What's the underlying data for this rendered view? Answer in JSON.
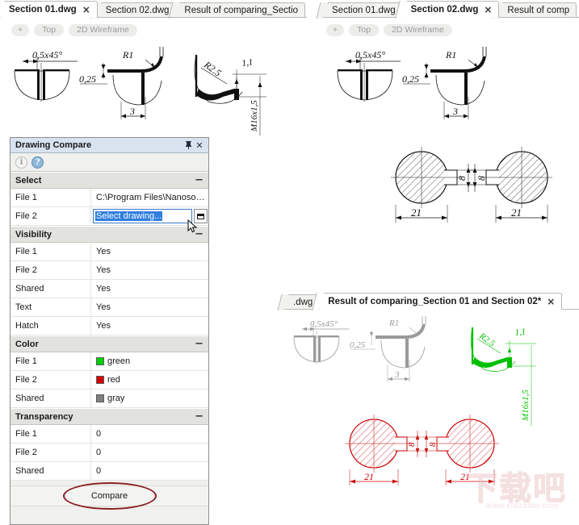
{
  "app": {
    "panel_title": "Drawing Compare"
  },
  "left_view": {
    "tabs": [
      {
        "label": "Section 01.dwg",
        "active": true,
        "close": "×"
      },
      {
        "label": "Section 02.dwg",
        "active": false,
        "close": ""
      },
      {
        "label": "Result of comparing_Sectio",
        "active": false,
        "close": ""
      }
    ],
    "viewbar": [
      "+",
      "Top",
      "2D Wireframe"
    ],
    "drawing_labels": [
      "0,5x45°",
      "0,25",
      "R1",
      "3",
      "R2.5",
      "1,1",
      "M16x1,5"
    ]
  },
  "right_view": {
    "tabs": [
      {
        "label": "Section 01.dwg",
        "active": false,
        "close": ""
      },
      {
        "label": "Section 02.dwg",
        "active": true,
        "close": "×"
      },
      {
        "label": "Result of comp",
        "active": false,
        "close": ""
      }
    ],
    "viewbar": [
      "+",
      "Top",
      "2D Wireframe"
    ],
    "drawing_labels": [
      "0,5x45°",
      "0,25",
      "R1",
      "3",
      "21",
      "8",
      "21",
      "8"
    ]
  },
  "result_view": {
    "tabs": [
      {
        "label": ".dwg",
        "active": false,
        "close": ""
      },
      {
        "label": "Result of comparing_Section 01 and Section 02*",
        "active": true,
        "close": "×"
      }
    ],
    "drawing_labels_shared": [
      "0,5x45°",
      "0,25",
      "R1",
      "3"
    ],
    "drawing_labels_green": [
      "R2.5",
      "1,1",
      "M16x1,5"
    ],
    "drawing_labels_red": [
      "21",
      "8",
      "21",
      "8"
    ]
  },
  "panel": {
    "title": "Drawing Compare",
    "pin_icon": "⏚",
    "close_icon": "✕",
    "toolbar": [
      {
        "icon": "info-icon",
        "glyph": "i"
      },
      {
        "icon": "help-icon",
        "glyph": "?"
      }
    ],
    "groups": [
      {
        "name": "Select",
        "collapse": "−",
        "rows": [
          {
            "key": "File 1",
            "value": "C:\\Program Files\\Nanoso…",
            "type": "text"
          },
          {
            "key": "File 2",
            "value": "Select drawing...",
            "type": "editing"
          }
        ]
      },
      {
        "name": "Visibility",
        "collapse": "−",
        "rows": [
          {
            "key": "File 1",
            "value": "Yes",
            "type": "text"
          },
          {
            "key": "File 2",
            "value": "Yes",
            "type": "text"
          },
          {
            "key": "Shared",
            "value": "Yes",
            "type": "text"
          },
          {
            "key": "Text",
            "value": "Yes",
            "type": "text"
          },
          {
            "key": "Hatch",
            "value": "Yes",
            "type": "text"
          }
        ]
      },
      {
        "name": "Color",
        "collapse": "−",
        "rows": [
          {
            "key": "File 1",
            "value": "green",
            "type": "color",
            "swatch": "#00d000"
          },
          {
            "key": "File 2",
            "value": "red",
            "type": "color",
            "swatch": "#d40000"
          },
          {
            "key": "Shared",
            "value": "gray",
            "type": "color",
            "swatch": "#808080"
          }
        ]
      },
      {
        "name": "Transparency",
        "collapse": "−",
        "rows": [
          {
            "key": "File 1",
            "value": "0",
            "type": "text"
          },
          {
            "key": "File 2",
            "value": "0",
            "type": "text"
          },
          {
            "key": "Shared",
            "value": "0",
            "type": "text"
          }
        ]
      }
    ],
    "compare_button": "Compare"
  },
  "watermark": {
    "text": "下载吧",
    "url": "www.xiazaiba.com"
  },
  "colors": {
    "green": "#00c000",
    "red": "#cc0000",
    "gray": "#9a9a9a",
    "black": "#111111",
    "highlight": "#8a1f22"
  }
}
